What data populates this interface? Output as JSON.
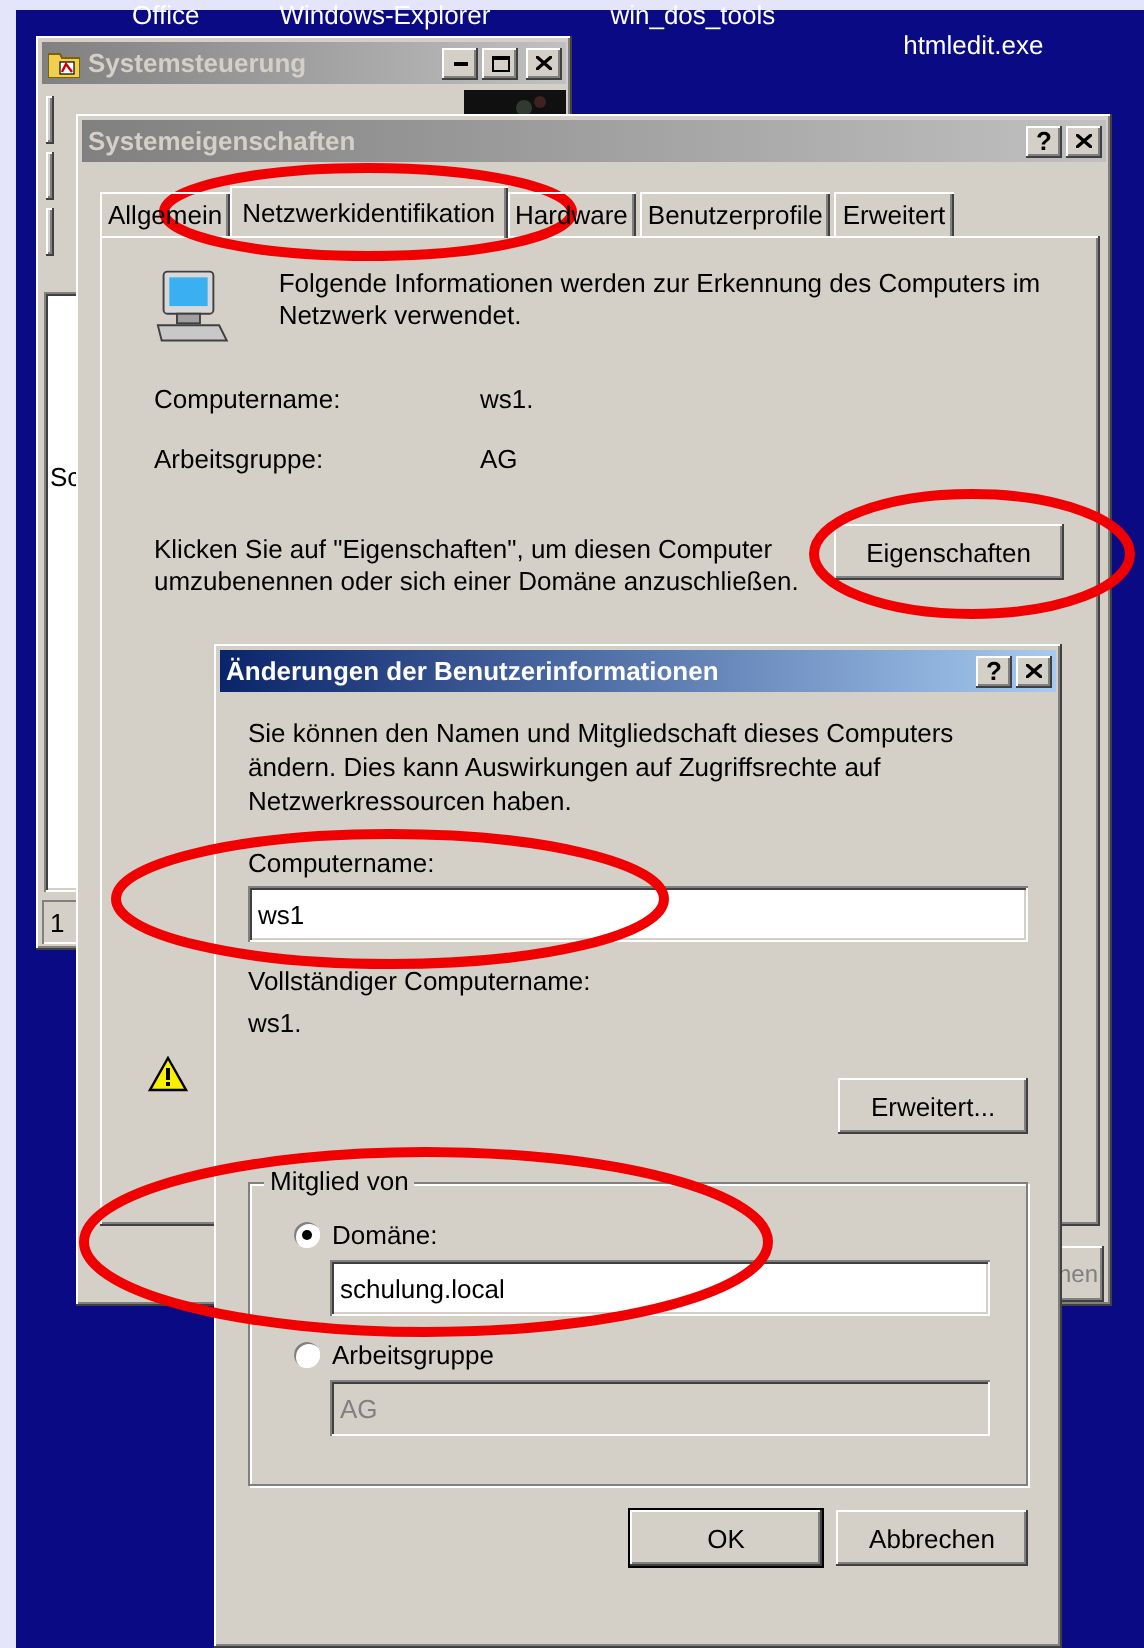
{
  "desktop": {
    "icons": [
      {
        "label": "Office"
      },
      {
        "label": "Windows-Explorer"
      },
      {
        "label": "win_dos_tools"
      },
      {
        "label": "htmledit.exe"
      }
    ]
  },
  "control_panel": {
    "title": "Systemsteuerung",
    "active": false,
    "pane_text": "Sc",
    "status_text": "1"
  },
  "system_properties": {
    "title": "Systemeigenschaften",
    "active": false,
    "help": "?",
    "tabs": [
      {
        "label": "Allgemein",
        "selected": false
      },
      {
        "label": "Netzwerkidentifikation",
        "selected": true,
        "circled": true
      },
      {
        "label": "Hardware",
        "selected": false
      },
      {
        "label": "Benutzerprofile",
        "selected": false
      },
      {
        "label": "Erweitert",
        "selected": false
      }
    ],
    "description": "Folgende Informationen werden zur Erkennung des Computers im Netzwerk verwendet.",
    "fields": [
      {
        "label": "Computername:",
        "value": "ws1."
      },
      {
        "label": "Arbeitsgruppe:",
        "value": "AG"
      }
    ],
    "hint": "Klicken Sie auf \"Eigenschaften\", um diesen Computer umzubenennen oder sich einer Domäne anzuschließen.",
    "properties_button": {
      "label": "Eigenschaften",
      "circled": true
    },
    "cut_button": "nen"
  },
  "dialog": {
    "title": "Änderungen der Benutzerinformationen",
    "active": true,
    "help": "?",
    "intro": "Sie können den Namen und Mitgliedschaft dieses Computers ändern. Dies kann Auswirkungen auf Zugriffsrechte auf Netzwerkressourcen haben.",
    "computer_name": {
      "label": "Computername:",
      "value": "ws1",
      "circled": true
    },
    "full_name_label": "Vollständiger Computername:",
    "full_name": "ws1.",
    "advanced_button": "Erweitert...",
    "member_of": {
      "legend": "Mitglied von",
      "circled": true,
      "options": [
        {
          "label": "Domäne:",
          "selected": true,
          "value": "schulung.local",
          "disabled": false
        },
        {
          "label": "Arbeitsgruppe",
          "selected": false,
          "value": "AG",
          "disabled": true
        }
      ]
    },
    "buttons": [
      {
        "label": "OK",
        "default": true
      },
      {
        "label": "Abbrechen",
        "default": false
      }
    ]
  }
}
